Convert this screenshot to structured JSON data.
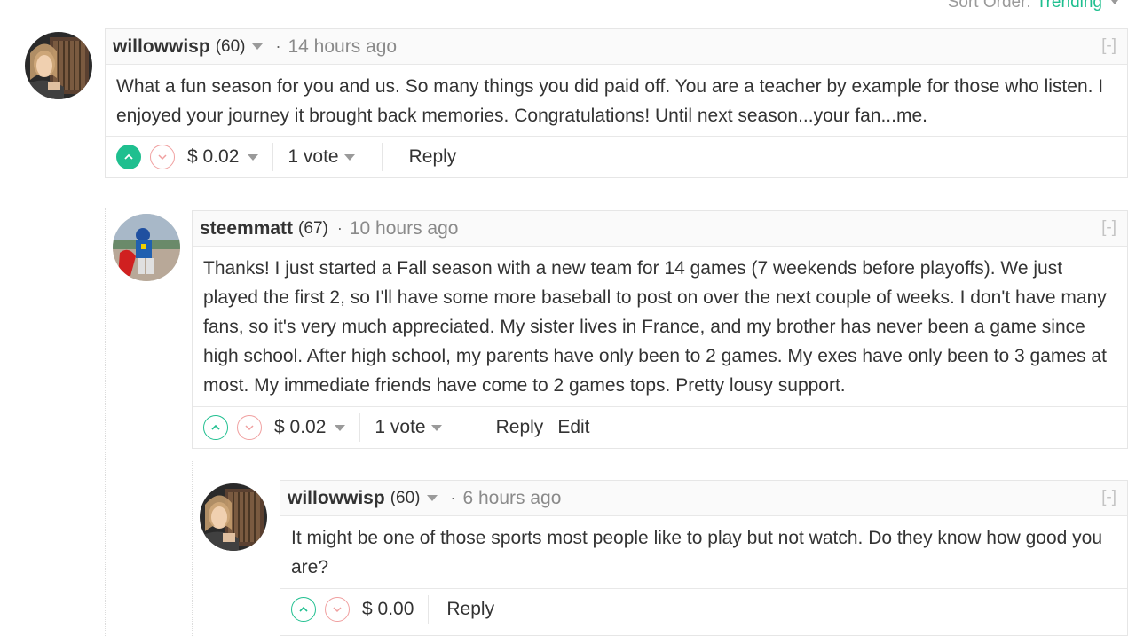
{
  "sort": {
    "label": "Sort Order:",
    "value": "Trending"
  },
  "comments": [
    {
      "author": "willowwisp",
      "reputation": "(60)",
      "dot": "·",
      "time": "14 hours ago",
      "collapse": "[-]",
      "body": "What a fun season for you and us. So many things you did paid off. You are a teacher by example for those who listen. I enjoyed your journey it brought back memories. Congratulations! Until next season...your fan...me.",
      "payout": "$ 0.02",
      "votes": "1 vote",
      "reply": "Reply",
      "upvoted": true
    },
    {
      "author": "steemmatt",
      "reputation": "(67)",
      "dot": "·",
      "time": "10 hours ago",
      "collapse": "[-]",
      "body": "Thanks! I just started a Fall season with a new team for 14 games (7 weekends before playoffs). We just played the first 2, so I'll have some more baseball to post on over the next couple of weeks. I don't have many fans, so it's very much appreciated. My sister lives in France, and my brother has never been a game since high school. After high school, my parents have only been to 2 games. My exes have only been to 3 games at most. My immediate friends have come to 2 games tops. Pretty lousy support.",
      "payout": "$ 0.02",
      "votes": "1 vote",
      "reply": "Reply",
      "edit": "Edit",
      "upvoted": false
    },
    {
      "author": "willowwisp",
      "reputation": "(60)",
      "dot": "·",
      "time": "6 hours ago",
      "collapse": "[-]",
      "body": "It might be one of those sports most people like to play but not watch. Do they know how good you are?",
      "payout": "$ 0.00",
      "reply": "Reply",
      "upvoted": false
    }
  ],
  "colors": {
    "accent": "#1fbf8f",
    "downvote": "#f0a0a0",
    "muted": "#8a8a8a"
  },
  "icons": {
    "upvote": "chevron-up-icon",
    "downvote": "chevron-down-icon",
    "dropdown": "caret-down-icon"
  }
}
